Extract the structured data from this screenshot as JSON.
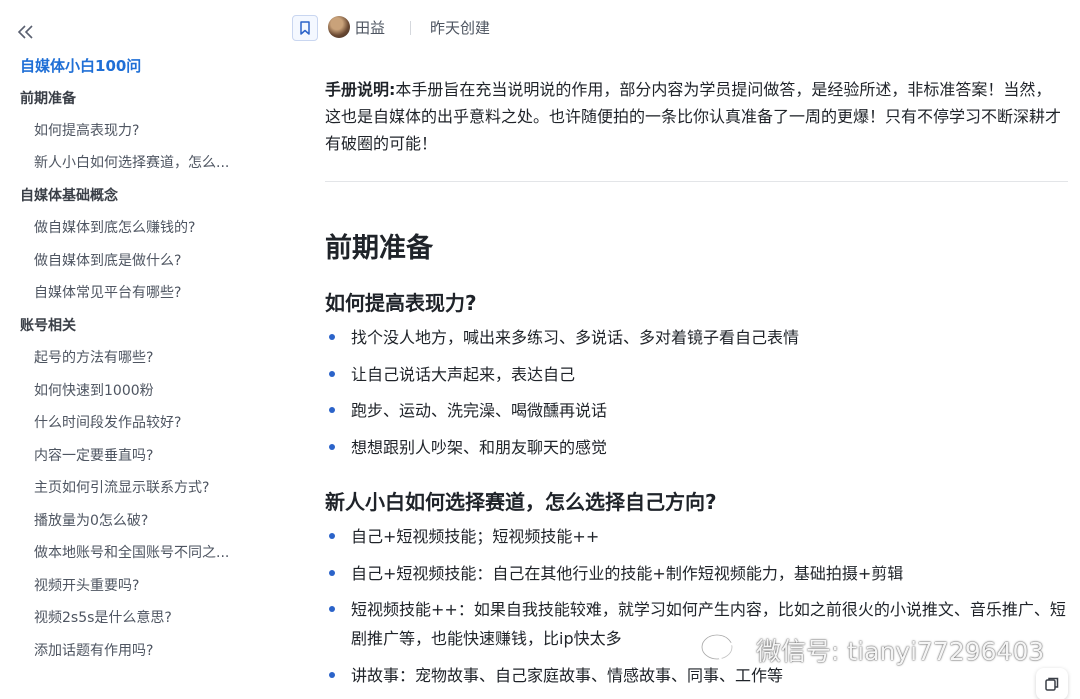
{
  "sidebar": {
    "title": "自媒体小白100问",
    "items": [
      {
        "label": "前期准备",
        "level": 1
      },
      {
        "label": "如何提高表现力?",
        "level": 2
      },
      {
        "label": "新人小白如何选择赛道，怎么...",
        "level": 2
      },
      {
        "label": "自媒体基础概念",
        "level": 1
      },
      {
        "label": "做自媒体到底怎么赚钱的?",
        "level": 2
      },
      {
        "label": "做自媒体到底是做什么?",
        "level": 2
      },
      {
        "label": "自媒体常见平台有哪些?",
        "level": 2
      },
      {
        "label": "账号相关",
        "level": 1
      },
      {
        "label": "起号的方法有哪些?",
        "level": 2
      },
      {
        "label": "如何快速到1000粉",
        "level": 2
      },
      {
        "label": "什么时间段发作品较好?",
        "level": 2
      },
      {
        "label": "内容一定要垂直吗?",
        "level": 2
      },
      {
        "label": "主页如何引流显示联系方式?",
        "level": 2
      },
      {
        "label": "播放量为0怎么破?",
        "level": 2
      },
      {
        "label": "做本地账号和全国账号不同之...",
        "level": 2
      },
      {
        "label": "视频开头重要吗?",
        "level": 2
      },
      {
        "label": "视频2s5s是什么意思?",
        "level": 2
      },
      {
        "label": "添加话题有作用吗?",
        "level": 2
      }
    ]
  },
  "header": {
    "author": "田益",
    "created": "昨天创建"
  },
  "doc": {
    "intro_label": "手册说明:",
    "intro_text": "本手册旨在充当说明说的作用，部分内容为学员提问做答，是经验所述，非标准答案！当然，这也是自媒体的出乎意料之处。也许随便拍的一条比你认真准备了一周的更爆！只有不停学习不断深耕才有破圈的可能！",
    "h1": "前期准备",
    "sections": [
      {
        "title": "如何提高表现力?",
        "bullets": [
          "找个没人地方，喊出来多练习、多说话、多对着镜子看自己表情",
          "让自己说话大声起来，表达自己",
          "跑步、运动、洗完澡、喝微醺再说话",
          "想想跟别人吵架、和朋友聊天的感觉"
        ]
      },
      {
        "title": "新人小白如何选择赛道，怎么选择自己方向?",
        "bullets": [
          "自己+短视频技能；短视频技能++",
          "自己+短视频技能：自己在其他行业的技能+制作短视频能力，基础拍摄+剪辑",
          "短视频技能++：如果自我技能较难，就学习如何产生内容，比如之前很火的小说推文、音乐推广、短剧推广等，也能快速赚钱，比ip快太多",
          "讲故事：宠物故事、自己家庭故事、情感故事、同事、工作等"
        ]
      }
    ]
  },
  "watermark": {
    "text": "微信号: tianyi77296403"
  },
  "colors": {
    "accent": "#1f6fd6",
    "bullet": "#2b63c9",
    "text": "#1f2329",
    "muted": "#4e5561"
  }
}
